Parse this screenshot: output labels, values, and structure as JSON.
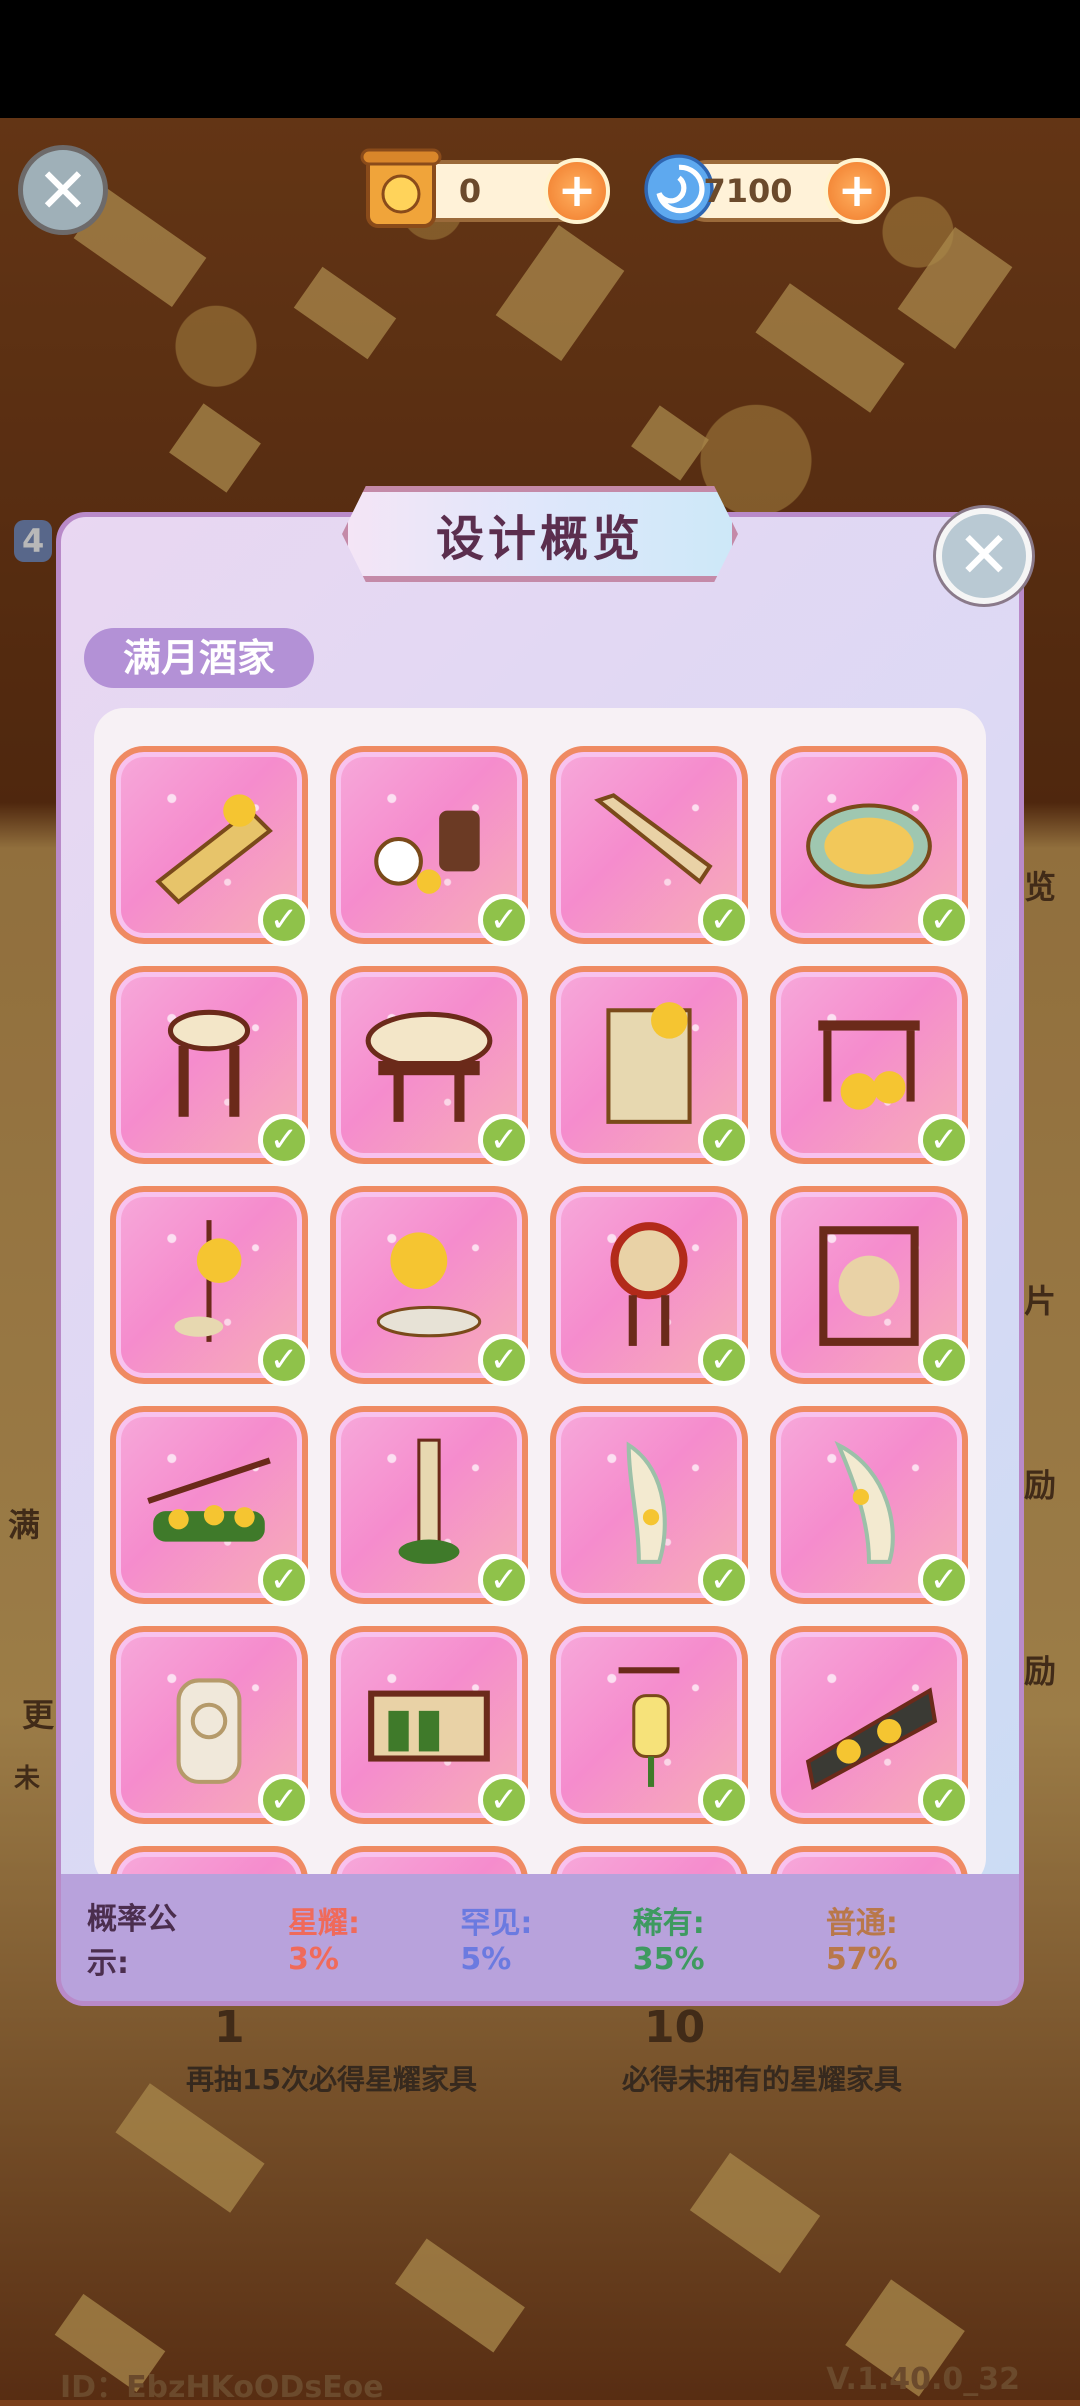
{
  "hud": {
    "currency_1": {
      "value": "0",
      "icon": "scroll-coin-icon"
    },
    "currency_2": {
      "value": "7100",
      "icon": "blue-swirl-icon"
    }
  },
  "modal": {
    "title": "设计概览",
    "set_name": "满月酒家",
    "items": [
      {
        "name": "golden-fan-icon",
        "owned": true
      },
      {
        "name": "tea-set-icon",
        "owned": true
      },
      {
        "name": "wooden-plank-icon",
        "owned": true
      },
      {
        "name": "round-tray-icon",
        "owned": true
      },
      {
        "name": "stool-icon",
        "owned": true
      },
      {
        "name": "round-table-icon",
        "owned": true
      },
      {
        "name": "painted-screen-icon",
        "owned": true
      },
      {
        "name": "flower-stand-icon",
        "owned": true
      },
      {
        "name": "hanging-plant-icon",
        "owned": true
      },
      {
        "name": "bonsai-icon",
        "owned": true
      },
      {
        "name": "drum-stand-icon",
        "owned": true
      },
      {
        "name": "lattice-screen-icon",
        "owned": true
      },
      {
        "name": "flower-railing-icon",
        "owned": true
      },
      {
        "name": "hanging-vine-icon",
        "owned": true
      },
      {
        "name": "curtain-left-icon",
        "owned": true
      },
      {
        "name": "curtain-right-icon",
        "owned": true
      },
      {
        "name": "stone-lion-icon",
        "owned": true
      },
      {
        "name": "cabinet-icon",
        "owned": true
      },
      {
        "name": "lantern-icon",
        "owned": true
      },
      {
        "name": "flower-panel-icon",
        "owned": true
      }
    ],
    "probability": {
      "label": "概率公示:",
      "star": "星耀: 3%",
      "rare1": "罕见: 5%",
      "rare2": "稀有: 35%",
      "common": "普通: 57%"
    }
  },
  "background": {
    "draw_one_count": "1",
    "draw_ten_count": "10",
    "draw_one_hint": "再抽15次必得星耀家具",
    "draw_ten_hint": "必得未拥有的星耀家具",
    "peek_left_1": "满",
    "peek_left_2": "更",
    "peek_left_3": "未",
    "peek_right_1": "览",
    "peek_right_2": "片",
    "peek_right_3": "励",
    "peek_right_4": "励",
    "peek_left_badge": "4"
  },
  "footer": {
    "id": "ID：EbzHKoODsEoe",
    "version": "V.1.40.0_32"
  },
  "colors": {
    "accent": "#ef8a62",
    "check": "#8fc24a",
    "modal_border": "#b98ac9"
  }
}
